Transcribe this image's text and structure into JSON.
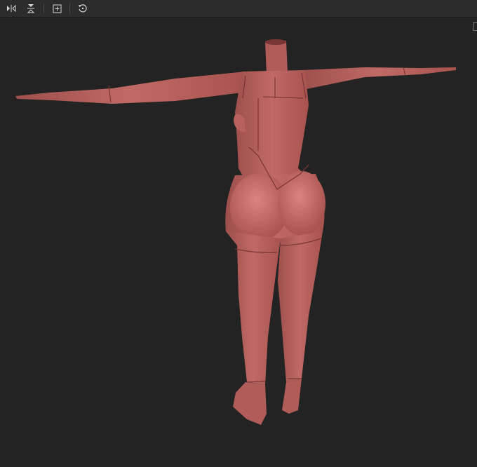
{
  "toolbar": {
    "tools": [
      {
        "icon": "mirror-x-icon"
      },
      {
        "icon": "mirror-y-icon"
      },
      {
        "icon": "frame-icon"
      },
      {
        "icon": "reset-view-icon"
      }
    ]
  },
  "viewport": {
    "background": "#232323",
    "model": {
      "pose": "t-pose",
      "view": "back",
      "color": "#b8625e",
      "seam_color": "#7a3634"
    }
  },
  "colors": {
    "toolbar_bg": "#2c2c2c",
    "icon": "#d6d6d6"
  }
}
